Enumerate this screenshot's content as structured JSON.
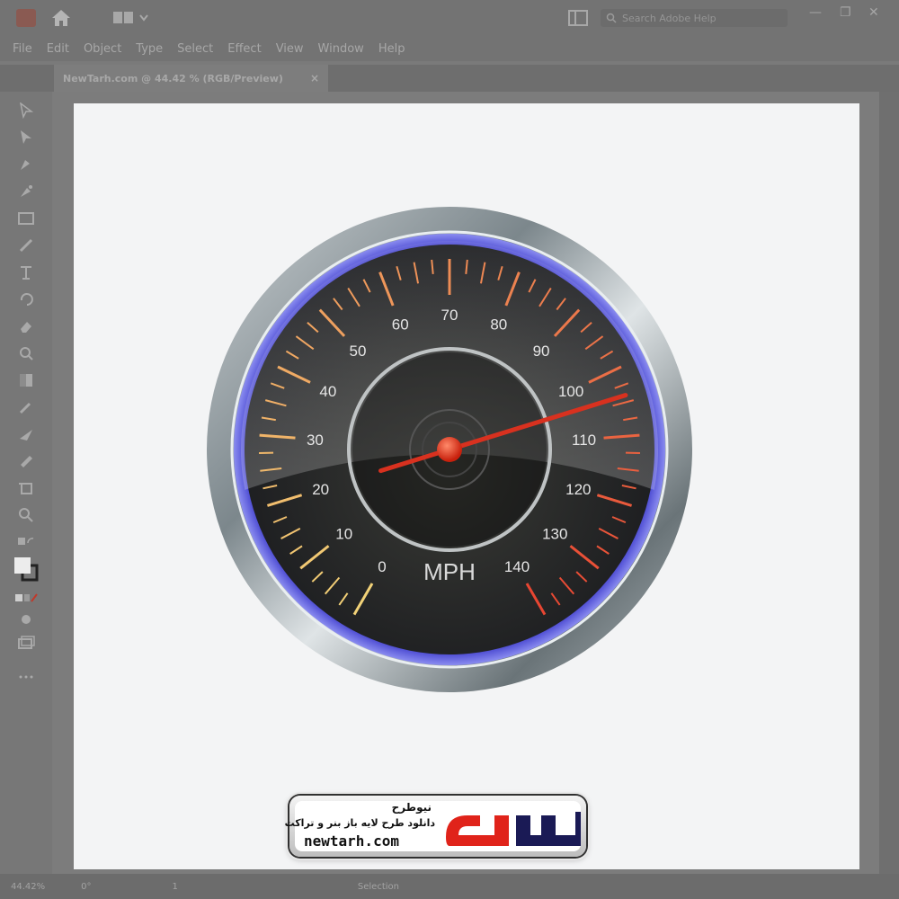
{
  "app": {
    "menu": [
      "File",
      "Edit",
      "Object",
      "Type",
      "Select",
      "Effect",
      "View",
      "Window",
      "Help"
    ],
    "document_tab": "NewTarh.com @ 44.42 % (RGB/Preview)",
    "tab_close": "×",
    "search_placeholder": "Search Adobe Help",
    "window_controls": {
      "minimize": "—",
      "restore": "❐",
      "close": "✕"
    }
  },
  "status": {
    "zoom": "44.42%",
    "rotation": "0°",
    "artboard": "1",
    "mode": "Selection"
  },
  "gauge": {
    "unit": "MPH",
    "min": 0,
    "max": 140,
    "needle_value": 104,
    "major_labels": [
      "0",
      "10",
      "20",
      "30",
      "40",
      "50",
      "60",
      "70",
      "80",
      "90",
      "100",
      "110",
      "120",
      "130",
      "140"
    ],
    "colors": {
      "bezel": "#9aa3a8",
      "glow": "#3b3ad8",
      "face": "#2e2f2b",
      "hub": "#e83a1a",
      "needle": "#d8311f",
      "text": "#e6e6e6"
    }
  },
  "watermark": {
    "fa_name": "نیوطرح",
    "fa_tagline": "دانلود طرح لایه باز بنر و تراکت",
    "site": "newtarh.com"
  }
}
